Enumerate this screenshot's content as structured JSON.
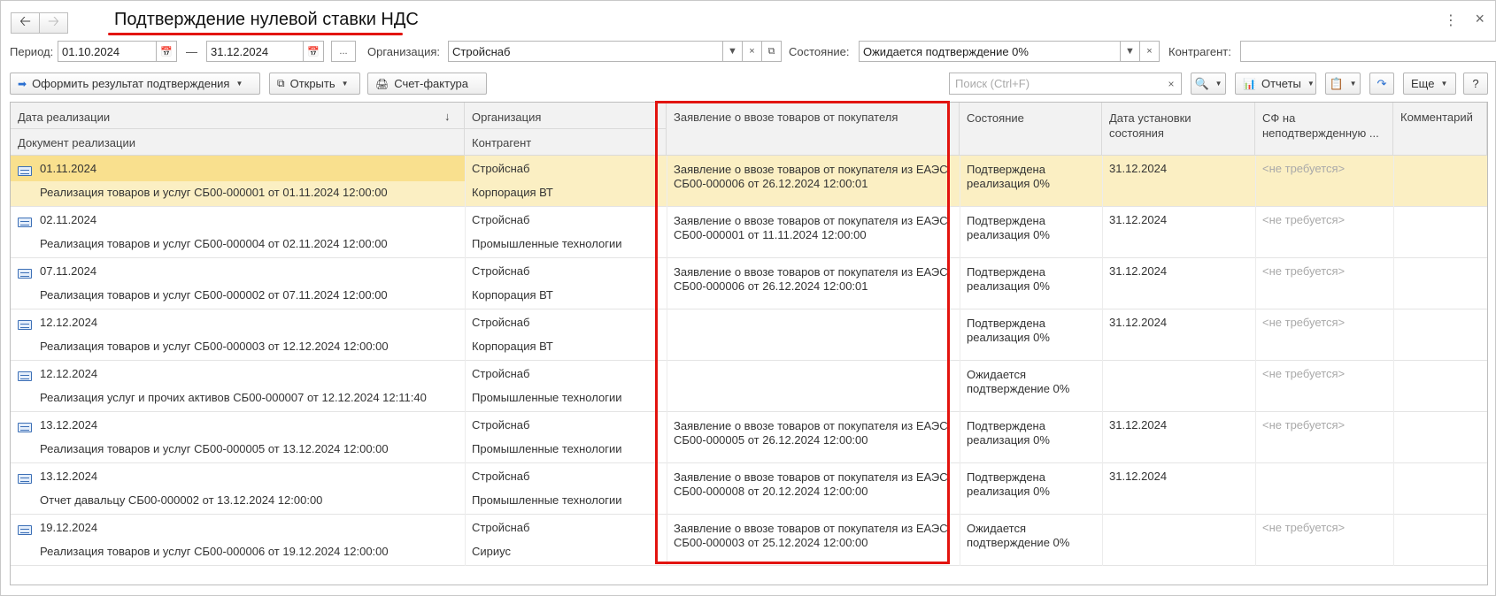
{
  "title": "Подтверждение нулевой ставки НДС",
  "filters": {
    "period_label": "Период:",
    "date_from": "01.10.2024",
    "dash": "—",
    "date_to": "31.12.2024",
    "more": "...",
    "org_label": "Организация:",
    "org_value": "Стройснаб",
    "state_label": "Состояние:",
    "state_value": "Ожидается подтверждение 0%",
    "counterparty_label": "Контрагент:",
    "counterparty_value": ""
  },
  "toolbar": {
    "result_btn": "Оформить результат подтверждения",
    "open_btn": "Открыть",
    "invoice_btn": "Счет-фактура",
    "search_placeholder": "Поиск (Ctrl+F)",
    "reports_btn": "Отчеты",
    "more_btn": "Еще",
    "help_btn": "?"
  },
  "columns": {
    "sale_date": "Дата реализации",
    "sale_doc": "Документ реализации",
    "org": "Организация",
    "counterparty": "Контрагент",
    "statement": "Заявление о ввозе товаров от покупателя",
    "state": "Состояние",
    "state_date": "Дата установки состояния",
    "invoice": "СФ на неподтвержденную ...",
    "comment": "Комментарий"
  },
  "rows": [
    {
      "date": "01.11.2024",
      "doc": "Реализация товаров и услуг СБ00-000001 от 01.11.2024 12:00:00",
      "org": "Стройснаб",
      "cp": "Корпорация ВТ",
      "stmt": "Заявление о ввозе товаров от покупателя из ЕАЭС СБ00-000006 от 26.12.2024 12:00:01",
      "state": "Подтверждена реализация 0%",
      "sdate": "31.12.2024",
      "inv": "<не требуется>",
      "comment": ""
    },
    {
      "date": "02.11.2024",
      "doc": "Реализация товаров и услуг СБ00-000004 от 02.11.2024 12:00:00",
      "org": "Стройснаб",
      "cp": "Промышленные технологии",
      "stmt": "Заявление о ввозе товаров от покупателя из ЕАЭС СБ00-000001 от 11.11.2024 12:00:00",
      "state": "Подтверждена реализация 0%",
      "sdate": "31.12.2024",
      "inv": "<не требуется>",
      "comment": ""
    },
    {
      "date": "07.11.2024",
      "doc": "Реализация товаров и услуг СБ00-000002 от 07.11.2024 12:00:00",
      "org": "Стройснаб",
      "cp": "Корпорация ВТ",
      "stmt": "Заявление о ввозе товаров от покупателя из ЕАЭС СБ00-000006 от 26.12.2024 12:00:01",
      "state": "Подтверждена реализация 0%",
      "sdate": "31.12.2024",
      "inv": "<не требуется>",
      "comment": ""
    },
    {
      "date": "12.12.2024",
      "doc": "Реализация товаров и услуг СБ00-000003 от 12.12.2024 12:00:00",
      "org": "Стройснаб",
      "cp": "Корпорация ВТ",
      "stmt": "",
      "state": "Подтверждена реализация 0%",
      "sdate": "31.12.2024",
      "inv": "<не требуется>",
      "comment": ""
    },
    {
      "date": "12.12.2024",
      "doc": "Реализация услуг и прочих активов СБ00-000007 от 12.12.2024 12:11:40",
      "org": "Стройснаб",
      "cp": "Промышленные технологии",
      "stmt": "",
      "state": "Ожидается подтверждение 0%",
      "sdate": "",
      "inv": "<не требуется>",
      "comment": ""
    },
    {
      "date": "13.12.2024",
      "doc": "Реализация товаров и услуг СБ00-000005 от 13.12.2024 12:00:00",
      "org": "Стройснаб",
      "cp": "Промышленные технологии",
      "stmt": "Заявление о ввозе товаров от покупателя из ЕАЭС СБ00-000005 от 26.12.2024 12:00:00",
      "state": "Подтверждена реализация 0%",
      "sdate": "31.12.2024",
      "inv": "<не требуется>",
      "comment": ""
    },
    {
      "date": "13.12.2024",
      "doc": "Отчет давальцу СБ00-000002 от 13.12.2024 12:00:00",
      "org": "Стройснаб",
      "cp": "Промышленные технологии",
      "stmt": "Заявление о ввозе товаров от покупателя из ЕАЭС СБ00-000008 от 20.12.2024 12:00:00",
      "state": "Подтверждена реализация 0%",
      "sdate": "31.12.2024",
      "inv": "",
      "comment": ""
    },
    {
      "date": "19.12.2024",
      "doc": "Реализация товаров и услуг СБ00-000006 от 19.12.2024 12:00:00",
      "org": "Стройснаб",
      "cp": "Сириус",
      "stmt": "Заявление о ввозе товаров от покупателя из ЕАЭС СБ00-000003 от 25.12.2024 12:00:00",
      "state": "Ожидается подтверждение 0%",
      "sdate": "",
      "inv": "<не требуется>",
      "comment": ""
    }
  ]
}
